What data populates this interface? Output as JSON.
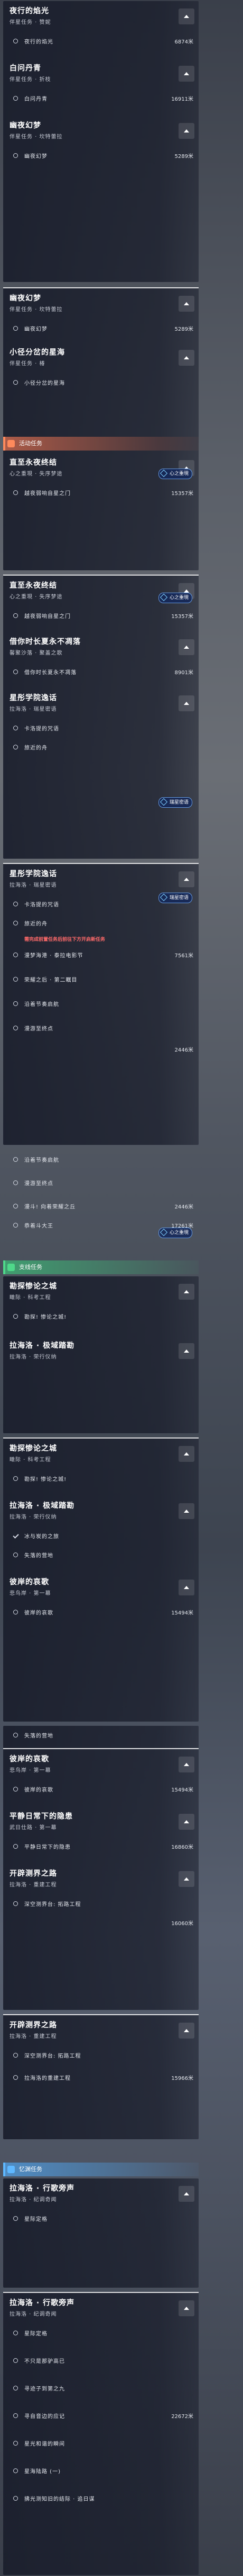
{
  "s1": {
    "q1": {
      "title": "夜行的焰光",
      "sub": "伴星任务 · 赞妮"
    },
    "i1": {
      "name": "夜行的焰光",
      "dist": "6874米"
    },
    "q2": {
      "title": "白问丹青",
      "sub": "伴星任务 · 折枝"
    },
    "i2": {
      "name": "白问丹青",
      "dist": "16911米"
    },
    "q3": {
      "title": "幽夜幻梦",
      "sub": "伴星任务 · 坎特蕾拉"
    },
    "i3": {
      "name": "幽夜幻梦",
      "dist": "5289米"
    }
  },
  "s2": {
    "q1": {
      "title": "幽夜幻梦",
      "sub": "伴星任务 · 坎特蕾拉"
    },
    "i1": {
      "name": "幽夜幻梦",
      "dist": "5289米"
    },
    "q2": {
      "title": "小径分岔的星海",
      "sub": "伴星任务 · 椿"
    },
    "i2": {
      "name": "小径分岔的星海"
    },
    "cat": "活动任务",
    "q3": {
      "title": "直至永夜终结",
      "sub": "心之重現 · 失序梦途"
    },
    "i3": {
      "name": "越夜弱响自星之门",
      "dist": "15357米"
    },
    "badge": "心之重現"
  },
  "s3": {
    "q1": {
      "title": "直至永夜终结",
      "sub": "心之重現 · 失序梦途"
    },
    "i1": {
      "name": "越夜弱响自星之门",
      "dist": "15357米"
    },
    "badge": "心之重現",
    "q2": {
      "title": "借你时长夏永不凋落",
      "sub": "馨聚沙落 · 聚盖之歌"
    },
    "i2": {
      "name": "借你时长夏永不凋落",
      "dist": "8901米"
    },
    "q3": {
      "title": "星彤学院逸话",
      "sub": "拉海洛 · 瑞星密语"
    },
    "i3": {
      "name": "卡洛提的咒语"
    },
    "i4": {
      "name": "旅近的舟"
    },
    "badge2": "瑞星密语"
  },
  "s4": {
    "q1": {
      "title": "星彤学院逸话",
      "sub": "拉海洛 · 瑞星密语"
    },
    "i1": {
      "name": "卡洛提的咒语"
    },
    "badge": "瑞星密语",
    "i2": {
      "name": "旅近的舟"
    },
    "warn": "需完成前置任务后前往下方开启新任务",
    "i3": {
      "name": "漫梦海港 · 泰拉电影节",
      "dist": "7561米"
    },
    "i4": {
      "name": "荣耀之后 · 第二瞩目"
    },
    "i5": {
      "name": "沿着节奏启航"
    },
    "i6": {
      "name": "漫游至终点"
    },
    "i7": {
      "name": "",
      "dist": "2446米"
    }
  },
  "s5": {
    "i1": {
      "name": "沿着节奏启航"
    },
    "i2": {
      "name": "漫游至终点"
    },
    "i3": {
      "name": "漫斗! 向着荣耀之丘",
      "dist": "2446米"
    },
    "i4": {
      "name": "恭着斗大王",
      "dist": "17261米"
    },
    "badge": "心之重現",
    "cat": "支线任务",
    "q1": {
      "title": "勘探惨论之城",
      "sub": "瞰际 · 科考工程"
    },
    "i5": {
      "name": "勘探! 惨论之城!"
    },
    "q2": {
      "title": "拉海洛 · 极域踏勘",
      "sub": "拉海洛 · 荣行仪纳"
    }
  },
  "s6": {
    "q1": {
      "title": "勘探惨论之城",
      "sub": "瞰际 · 科考工程"
    },
    "i1": {
      "name": "勘探! 惨论之城!"
    },
    "q2": {
      "title": "拉海洛 · 极域踏勘",
      "sub": "拉海洛 · 荣行仪纳"
    },
    "i2": {
      "name": "冰与炭的之旅"
    },
    "i3": {
      "name": "失落的营地"
    },
    "q3": {
      "title": "彼岸的哀歌",
      "sub": "悲鸟岸 · 第一幕"
    },
    "i4": {
      "name": "彼岸的哀歌",
      "dist": "15494米"
    }
  },
  "s7": {
    "i1": {
      "name": "失落的营地"
    },
    "q1": {
      "title": "彼岸的哀歌",
      "sub": "悲鸟岸 · 第一幕"
    },
    "i2": {
      "name": "彼岸的哀歌",
      "dist": "15494米"
    },
    "q2": {
      "title": "平静日常下的隐患",
      "sub": "武日仕路 · 第一幕"
    },
    "i3": {
      "name": "平静日常下的隐患",
      "dist": "16860米"
    },
    "q3": {
      "title": "开辟测界之路",
      "sub": "拉海洛 · 重建工程"
    },
    "i4": {
      "name": "深空测界台: 拓路工程"
    },
    "i5": {
      "name": "",
      "dist": "16060米"
    }
  },
  "s8": {
    "q1": {
      "title": "开辟测界之路",
      "sub": "拉海洛 · 重建工程"
    },
    "i1": {
      "name": "深空测界台: 拓路工程"
    },
    "i2": {
      "name": "拉海洛的重建工程",
      "dist": "15966米"
    },
    "cat": "忆渊任务",
    "q2": {
      "title": "拉海洛 · 行歌旁声",
      "sub": "拉海洛 · 纪调奇闻"
    },
    "i3": {
      "name": "星际定格"
    }
  },
  "s9": {
    "q1": {
      "title": "拉海洛 · 行歌旁声",
      "sub": "拉海洛 · 纪调奇闻"
    },
    "i1": {
      "name": "星际定格"
    },
    "i2": {
      "name": "不只是那驴高已"
    },
    "i3": {
      "name": "寻迹子到第之九"
    },
    "i4": {
      "name": "寻自音边的应记",
      "dist": "22672米"
    },
    "i5": {
      "name": "星光和谐的瞬间"
    },
    "i6": {
      "name": "星海陆路 (一)"
    },
    "i7": {
      "name": "拂光测知旧的结际 · 追日谋"
    }
  }
}
